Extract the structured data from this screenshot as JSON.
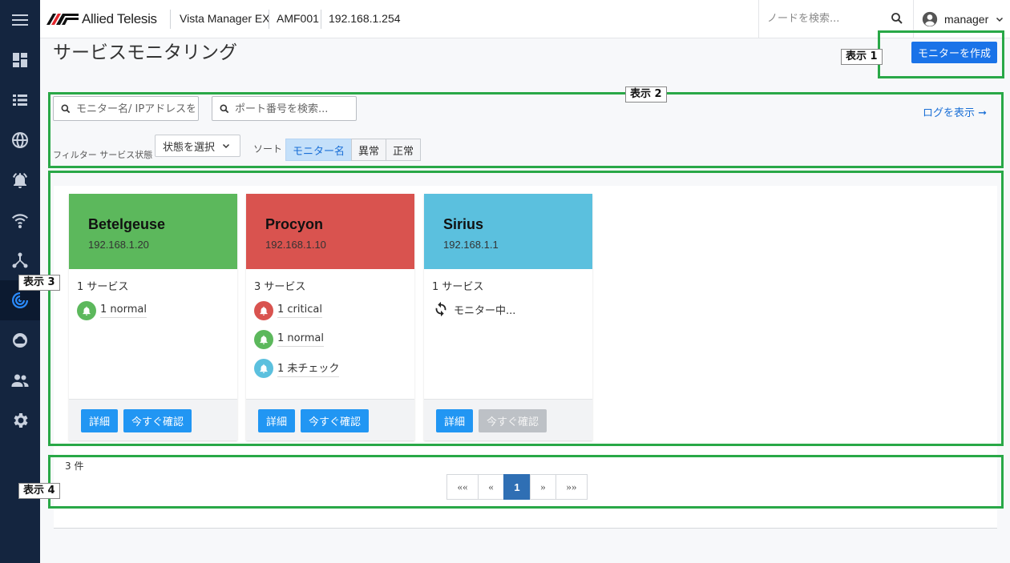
{
  "header": {
    "brand": "Allied Telesis",
    "product": "Vista Manager EX",
    "device": "AMF001",
    "ip": "192.168.1.254",
    "node_search_placeholder": "ノードを検索...",
    "user": "manager"
  },
  "sidebar": {
    "items": [
      {
        "icon": "menu-icon"
      },
      {
        "icon": "dashboard-icon"
      },
      {
        "icon": "list-icon"
      },
      {
        "icon": "globe-icon"
      },
      {
        "icon": "alarm-icon"
      },
      {
        "icon": "wifi-icon"
      },
      {
        "icon": "topology-icon"
      },
      {
        "icon": "service-monitor-icon",
        "active": true
      },
      {
        "icon": "cloud-icon"
      },
      {
        "icon": "users-icon"
      },
      {
        "icon": "settings-icon"
      }
    ]
  },
  "page": {
    "title": "サービスモニタリング",
    "create_button": "モニターを作成"
  },
  "filters": {
    "monitor_search_placeholder": "モニター名/ IPアドレスを",
    "port_search_placeholder": "ポート番号を検索...",
    "log_link": "ログを表示",
    "filter_label": "フィルター サービス状態",
    "state_select": "状態を選択",
    "sort_label": "ソート",
    "sort_options": [
      "モニター名",
      "異常",
      "正常"
    ]
  },
  "annotations": {
    "a1": "表示 1",
    "a2": "表示 2",
    "a3": "表示 3",
    "a4": "表示 4"
  },
  "cards": [
    {
      "name": "Betelgeuse",
      "ip": "192.168.1.20",
      "color": "#5cb85c",
      "service_count": "1 サービス",
      "statuses": [
        {
          "label": "1 normal",
          "color": "#5cb85c"
        }
      ],
      "detail": "詳細",
      "check": "今すぐ確認"
    },
    {
      "name": "Procyon",
      "ip": "192.168.1.10",
      "color": "#d9534f",
      "service_count": "3 サービス",
      "statuses": [
        {
          "label": "1 critical",
          "color": "#d9534f"
        },
        {
          "label": "1 normal",
          "color": "#5cb85c"
        },
        {
          "label": "1 未チェック",
          "color": "#5bc0de"
        }
      ],
      "detail": "詳細",
      "check": "今すぐ確認"
    },
    {
      "name": "Sirius",
      "ip": "192.168.1.1",
      "color": "#5bc0de",
      "service_count": "1 サービス",
      "monitoring": "モニター中...",
      "detail": "詳細",
      "check": "今すぐ確認"
    }
  ],
  "footer": {
    "count": "3 件",
    "pager": [
      "««",
      "«",
      "1",
      "»",
      "»»"
    ]
  }
}
